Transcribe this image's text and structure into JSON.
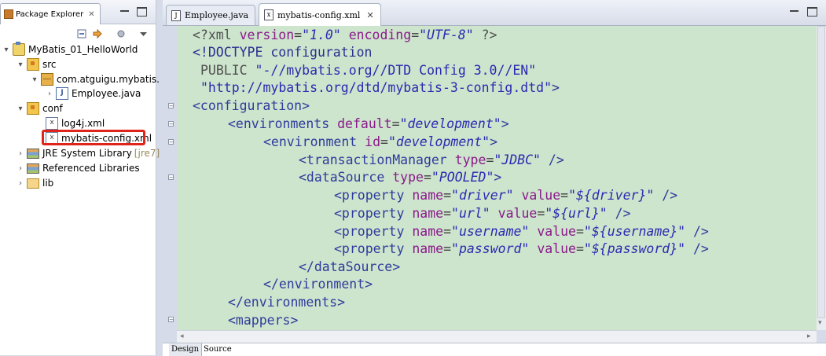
{
  "package_explorer": {
    "tab_label": "Package Explorer",
    "tree": [
      {
        "label": "MyBatis_01_HelloWorld",
        "icon": "project-icon",
        "twisty": "expanded"
      },
      {
        "label": "src",
        "icon": "source-folder-icon",
        "twisty": "expanded"
      },
      {
        "label": "com.atguigu.mybatis.",
        "icon": "package-icon",
        "twisty": "expanded"
      },
      {
        "label": "Employee.java",
        "icon": "java-file-icon",
        "twisty": "collapsed"
      },
      {
        "label": "conf",
        "icon": "source-folder-icon",
        "twisty": "expanded"
      },
      {
        "label": "log4j.xml",
        "icon": "xml-file-icon",
        "twisty": "none"
      },
      {
        "label": "mybatis-config.xml",
        "icon": "xml-file-icon",
        "twisty": "none"
      },
      {
        "label": "JRE System Library",
        "suffix": "[jre7]",
        "icon": "library-icon",
        "twisty": "collapsed"
      },
      {
        "label": "Referenced Libraries",
        "icon": "library-icon",
        "twisty": "collapsed"
      },
      {
        "label": "lib",
        "icon": "folder-icon",
        "twisty": "collapsed"
      }
    ],
    "highlight_color": "#e0241b"
  },
  "editor": {
    "tabs": [
      {
        "label": "Employee.java",
        "icon": "java-file-icon"
      },
      {
        "label": "mybatis-config.xml",
        "icon": "xml-file-icon",
        "active": true
      }
    ],
    "background_color": "#cde4cd",
    "lines": {
      "l1": {
        "a": "<?xml ",
        "b": "version",
        "c": "=",
        "d": "\"1.0\"",
        "e": " ",
        "f": "encoding",
        "g": "=",
        "h": "\"UTF-8\"",
        "i": " ?>"
      },
      "l2": {
        "a": "<!DOCTYPE configuration"
      },
      "l3": {
        "a": "PUBLIC ",
        "b": "\"-//mybatis.org//DTD Config 3.0//EN\""
      },
      "l4": {
        "a": "\"http://mybatis.org/dtd/mybatis-3-config.dtd\"",
        "b": ">"
      },
      "l5": {
        "a": "<configuration>"
      },
      "l6": {
        "a": "<environments ",
        "b": "default",
        "c": "=",
        "d": "\"development\"",
        "e": ">"
      },
      "l7": {
        "a": "<environment ",
        "b": "id",
        "c": "=",
        "d": "\"development\"",
        "e": ">"
      },
      "l8": {
        "a": "<transactionManager ",
        "b": "type",
        "c": "=",
        "d": "\"JDBC\"",
        "e": " />"
      },
      "l9": {
        "a": "<dataSource ",
        "b": "type",
        "c": "=",
        "d": "\"POOLED\"",
        "e": ">"
      },
      "l10": {
        "a": "<property ",
        "b": "name",
        "c": "=",
        "d": "\"driver\"",
        "e": " ",
        "f": "value",
        "g": "=",
        "h": "\"${driver}\"",
        "i": " />"
      },
      "l11": {
        "a": "<property ",
        "b": "name",
        "c": "=",
        "d": "\"url\"",
        "e": " ",
        "f": "value",
        "g": "=",
        "h": "\"${url}\"",
        "i": " />"
      },
      "l12": {
        "a": "<property ",
        "b": "name",
        "c": "=",
        "d": "\"username\"",
        "e": " ",
        "f": "value",
        "g": "=",
        "h": "\"${username}\"",
        "i": " />"
      },
      "l13": {
        "a": "<property ",
        "b": "name",
        "c": "=",
        "d": "\"password\"",
        "e": " ",
        "f": "value",
        "g": "=",
        "h": "\"${password}\"",
        "i": " />"
      },
      "l14": {
        "a": "</dataSource>"
      },
      "l15": {
        "a": "</environment>"
      },
      "l16": {
        "a": "</environments>"
      },
      "l17": {
        "a": "<mappers>"
      }
    },
    "bottom_tabs": [
      "Design",
      "Source"
    ]
  }
}
